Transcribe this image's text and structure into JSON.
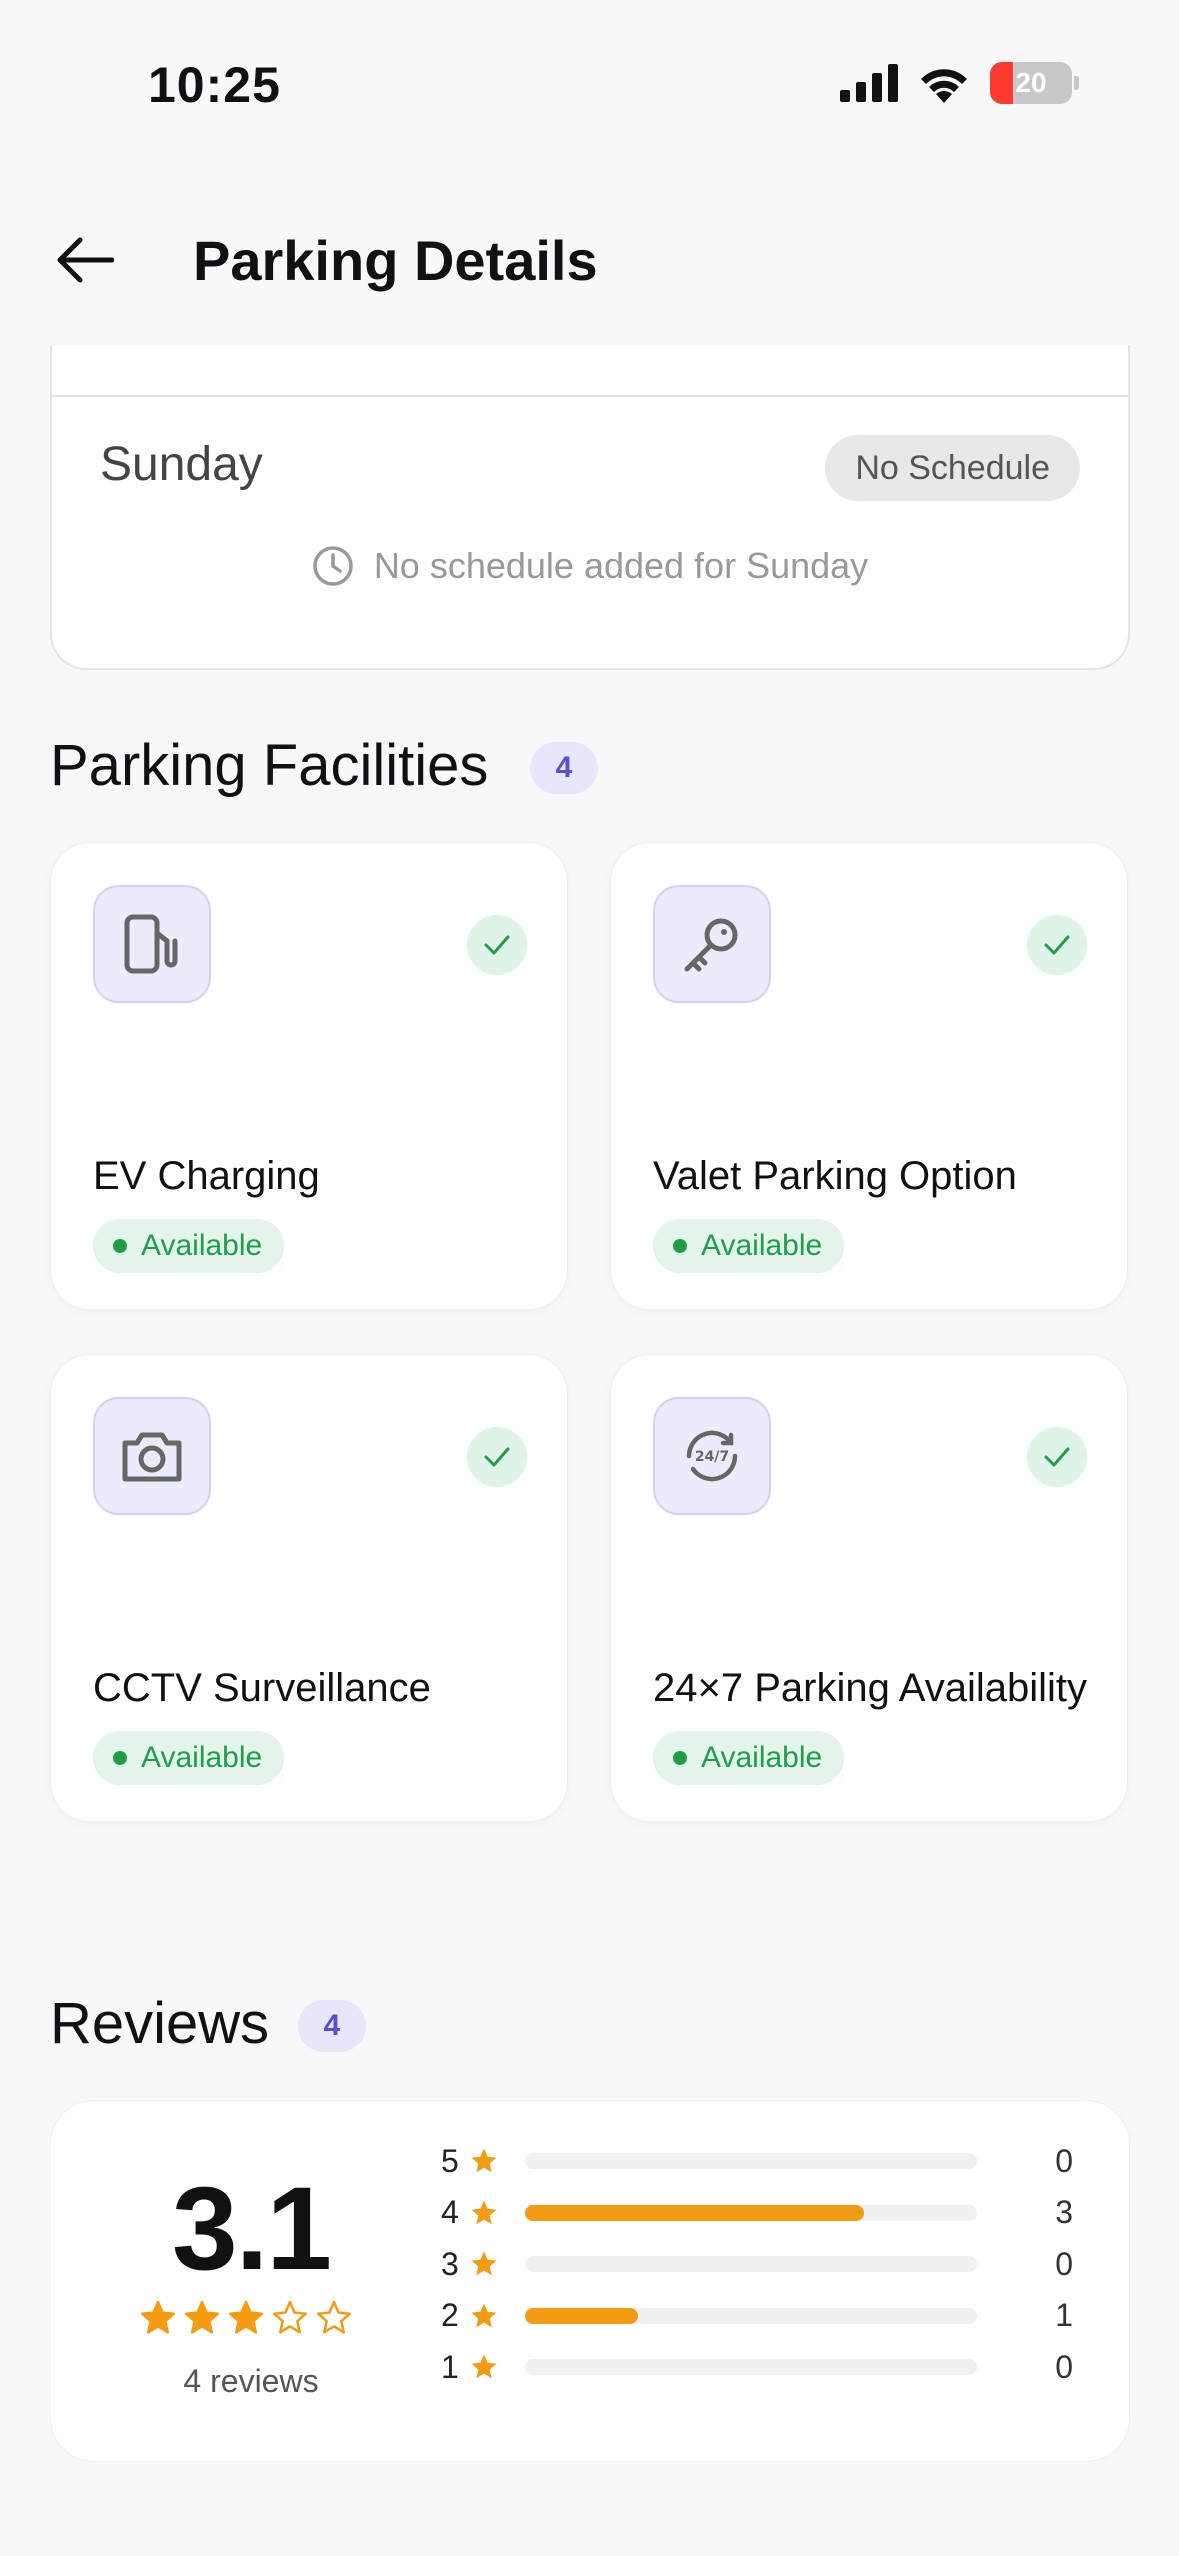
{
  "status_bar": {
    "time": "10:25",
    "battery": "20"
  },
  "header": {
    "title": "Parking Details"
  },
  "schedule": {
    "day": "Sunday",
    "badge": "No Schedule",
    "empty_message": "No schedule added for Sunday"
  },
  "facilities": {
    "title": "Parking Facilities",
    "count": "4",
    "items": [
      {
        "name": "EV Charging",
        "status": "Available",
        "icon": "ev-charger-icon"
      },
      {
        "name": "Valet Parking Option",
        "status": "Available",
        "icon": "key-icon"
      },
      {
        "name": "CCTV Surveillance",
        "status": "Available",
        "icon": "camera-icon"
      },
      {
        "name": "24×7 Parking Availability",
        "status": "Available",
        "icon": "clock-24-7-icon"
      }
    ]
  },
  "reviews": {
    "title": "Reviews",
    "count": "4",
    "average": "3.1",
    "average_stars_filled": 3,
    "total_label": "4 reviews",
    "distribution": [
      {
        "stars": "5",
        "count": "0",
        "fraction": 0
      },
      {
        "stars": "4",
        "count": "3",
        "fraction": 0.75
      },
      {
        "stars": "3",
        "count": "0",
        "fraction": 0
      },
      {
        "stars": "2",
        "count": "1",
        "fraction": 0.25
      },
      {
        "stars": "1",
        "count": "0",
        "fraction": 0
      }
    ]
  },
  "colors": {
    "accent": "#5b4ed6",
    "available": "#1f9d4c",
    "star": "#f39c12"
  }
}
